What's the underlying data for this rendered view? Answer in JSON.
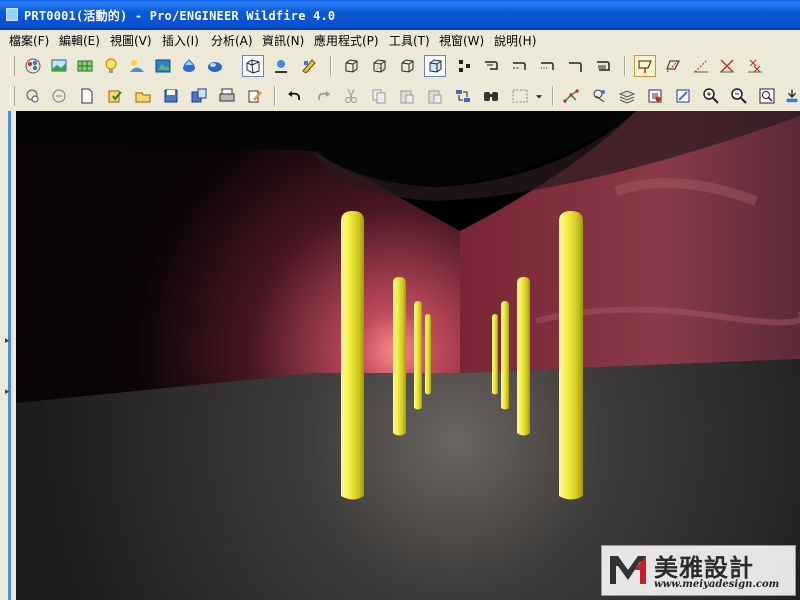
{
  "window": {
    "title": "PRT0001(活動的) - Pro/ENGINEER Wildfire 4.0"
  },
  "menubar": {
    "items": [
      {
        "label": "檔案(F)"
      },
      {
        "label": "編輯(E)"
      },
      {
        "label": "視圖(V)"
      },
      {
        "label": "插入(I)"
      },
      {
        "label": "分析(A)"
      },
      {
        "label": "資訊(N)"
      },
      {
        "label": "應用程式(P)"
      },
      {
        "label": "工具(T)"
      },
      {
        "label": "視窗(W)"
      },
      {
        "label": "說明(H)"
      }
    ]
  },
  "toolbar_top": {
    "icons": [
      "appearance-gallery-icon",
      "model-setup-icon",
      "room-editor-icon",
      "light-editor-icon",
      "scene-icon",
      "environment-icon",
      "perspective-icon",
      "render-icon",
      "render-window-icon",
      "region-render-icon",
      "palette-icon",
      "wireframe-icon",
      "hidden-line-icon",
      "no-hidden-icon",
      "shading-icon",
      "model-tree-icon",
      "datum-plane-icon",
      "datum-axis-icon",
      "datum-curve-icon",
      "datum-point-icon",
      "coord-sys-icon",
      "planes-display-icon",
      "axes-display-icon",
      "points-display-icon",
      "csys-display-icon",
      "annotation-display-icon"
    ]
  },
  "toolbar_bottom": {
    "icons": [
      "new-icon",
      "open-icon",
      "save-icon",
      "save-copy-icon",
      "print-icon",
      "send-mail-icon",
      "undo-icon",
      "redo-icon",
      "cut-icon",
      "copy-icon",
      "paste-icon",
      "paste-special-icon",
      "regenerate-icon",
      "find-icon",
      "selection-filter-icon",
      "datum-point-tool-icon",
      "sketch-icon",
      "layers-icon",
      "spin-center-icon",
      "refit-icon",
      "zoom-in-icon",
      "zoom-out-icon",
      "zoom-window-icon",
      "view-manager-icon"
    ]
  },
  "scene": {
    "floor_color": "#3a3a38",
    "sky_top_color": "#050505",
    "wall_glow_color": "#c04a5d",
    "pillar_color": "#e9e63a"
  },
  "watermark": {
    "title": "美雅設計",
    "url": "www.meiyadesign.com"
  }
}
